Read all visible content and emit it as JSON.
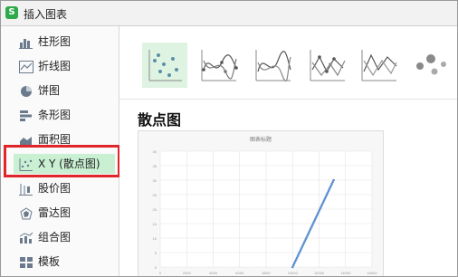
{
  "window": {
    "app_icon": "S",
    "title": "插入图表"
  },
  "sidebar": {
    "items": [
      {
        "label": "柱形图",
        "icon": "column-chart-icon"
      },
      {
        "label": "折线图",
        "icon": "line-chart-icon"
      },
      {
        "label": "饼图",
        "icon": "pie-chart-icon"
      },
      {
        "label": "条形图",
        "icon": "bar-chart-icon"
      },
      {
        "label": "面积图",
        "icon": "area-chart-icon"
      },
      {
        "label": "X Y (散点图)",
        "icon": "scatter-chart-icon"
      },
      {
        "label": "股价图",
        "icon": "stock-chart-icon"
      },
      {
        "label": "雷达图",
        "icon": "radar-chart-icon"
      },
      {
        "label": "组合图",
        "icon": "combo-chart-icon"
      },
      {
        "label": "模板",
        "icon": "template-icon"
      }
    ],
    "selected_index": 5
  },
  "subtypes": [
    {
      "name": "scatter-markers-only-icon",
      "active": true
    },
    {
      "name": "scatter-smooth-lines-markers-icon",
      "active": false
    },
    {
      "name": "scatter-smooth-lines-icon",
      "active": false
    },
    {
      "name": "scatter-straight-lines-markers-icon",
      "active": false
    },
    {
      "name": "scatter-straight-lines-icon",
      "active": false
    },
    {
      "name": "bubble-chart-icon",
      "active": false
    }
  ],
  "preview": {
    "section_title": "散点图"
  },
  "chart_data": {
    "type": "scatter",
    "title": "图表标题",
    "xlabel": "",
    "ylabel": "",
    "xlim": [
      0,
      16000
    ],
    "ylim": [
      0,
      40
    ],
    "x_ticks": [
      "0",
      "2000",
      "4000",
      "6000",
      "8000",
      "10000",
      "12000",
      "14000",
      "16000"
    ],
    "y_ticks": [
      "0",
      "5",
      "10",
      "15",
      "20",
      "25",
      "30",
      "35",
      "40"
    ],
    "grid": true,
    "series": [
      {
        "x_start": 10000,
        "x_end": 13100,
        "y_start": 0,
        "y_end": 30,
        "count": 48,
        "color": "#5b8fd0"
      }
    ]
  },
  "colors": {
    "accent_green": "#2eaa4c",
    "selected_bg": "#c9f0d3",
    "highlight_red": "#e0262a"
  }
}
